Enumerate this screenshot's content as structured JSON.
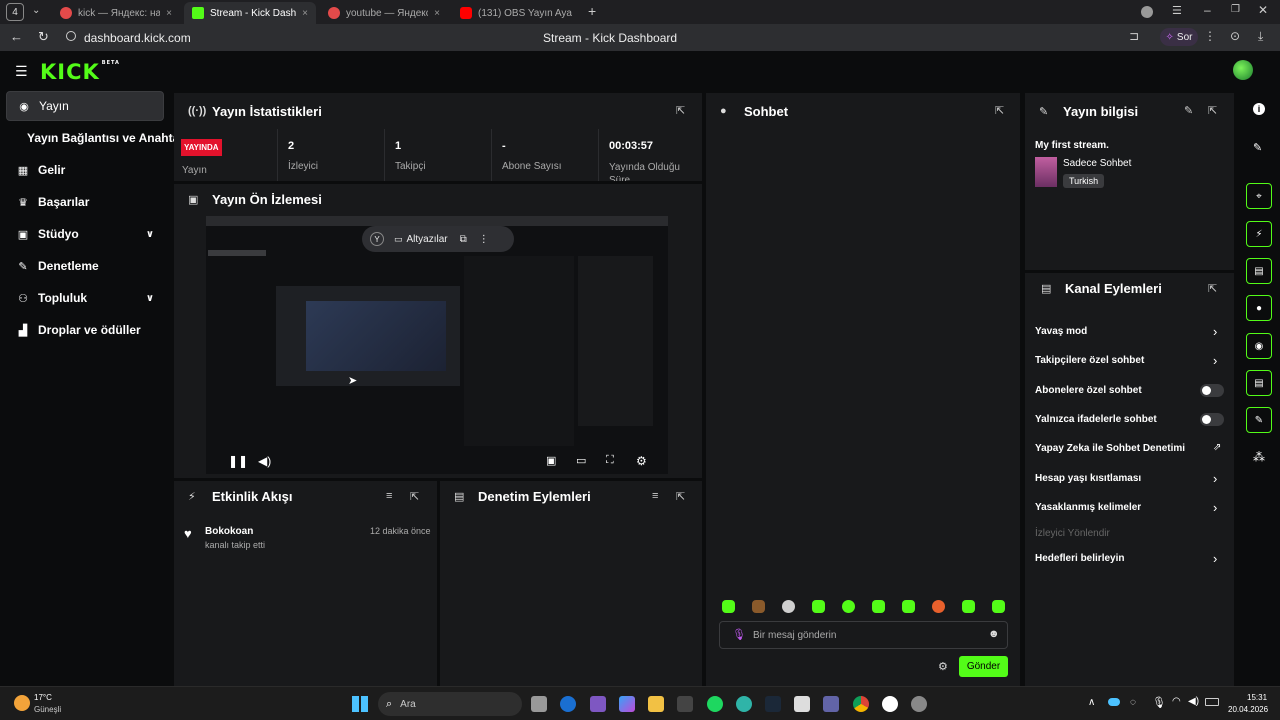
{
  "browser": {
    "tab_count": "4",
    "tabs": [
      {
        "label": "kick — Яндекс: нашлось 1",
        "close": "×"
      },
      {
        "label": "Stream - Kick Dashboard",
        "close": "×"
      },
      {
        "label": "youtube — Яндекс: нашло",
        "close": "×"
      },
      {
        "label": "(131) OBS Yayın Ayarları N",
        "close": ""
      }
    ],
    "new_tab": "+",
    "url": "dashboard.kick.com",
    "page_title": "Stream - Kick Dashboard",
    "ask_label": "Sor"
  },
  "header": {
    "logo": "KICK",
    "logo_sup": "BETA"
  },
  "sidebar": {
    "items": [
      {
        "label": "Yayın"
      },
      {
        "label": "Yayın Bağlantısı ve Anahtarı"
      },
      {
        "label": "Gelir"
      },
      {
        "label": "Başarılar"
      },
      {
        "label": "Stüdyo"
      },
      {
        "label": "Denetleme"
      },
      {
        "label": "Topluluk"
      },
      {
        "label": "Droplar ve ödüller"
      }
    ]
  },
  "stats": {
    "title": "Yayın İstatistikleri",
    "live_badge": "YAYINDA",
    "live_label": "Yayın",
    "items": [
      {
        "value": "2",
        "label": "İzleyici"
      },
      {
        "value": "1",
        "label": "Takipçi"
      },
      {
        "value": "-",
        "label": "Abone Sayısı"
      },
      {
        "value": "00:03:57",
        "label": "Yayında Olduğu Süre"
      }
    ]
  },
  "preview": {
    "title": "Yayın Ön İzlemesi",
    "subtitles": "Altyazılar"
  },
  "activity": {
    "title": "Etkinlik Akışı",
    "entries": [
      {
        "user": "Bokokoan",
        "text": "kanalı takip etti",
        "time": "12 dakika önce"
      }
    ]
  },
  "moderation": {
    "title": "Denetim Eylemleri"
  },
  "chat": {
    "title": "Sohbet",
    "placeholder": "Bir mesaj gönderin",
    "send": "Gönder"
  },
  "stream_info": {
    "title": "Yayın bilgisi",
    "stream_title": "My first stream.",
    "category": "Sadece Sohbet",
    "language": "Turkish"
  },
  "channel_actions": {
    "title": "Kanal Eylemleri",
    "items": [
      {
        "label": "Yavaş mod"
      },
      {
        "label": "Takipçilere özel sohbet"
      },
      {
        "label": "Abonelere özel sohbet"
      },
      {
        "label": "Yalnızca ifadelerle sohbet"
      },
      {
        "label": "Yapay Zeka ile Sohbet Denetimi"
      },
      {
        "label": "Hesap yaşı kısıtlaması"
      },
      {
        "label": "Yasaklanmış kelimeler"
      },
      {
        "label": "İzleyici Yönlendir"
      },
      {
        "label": "Hedefleri belirleyin"
      }
    ]
  },
  "taskbar": {
    "weather_temp": "17°C",
    "weather_text": "Güneşli",
    "search": "Ara",
    "time": "15:31",
    "date": "20.04.2026"
  },
  "colors": {
    "accent": "#53fc18",
    "live": "#e3122c",
    "panel": "#18191b",
    "background": "#0b0c0d"
  }
}
